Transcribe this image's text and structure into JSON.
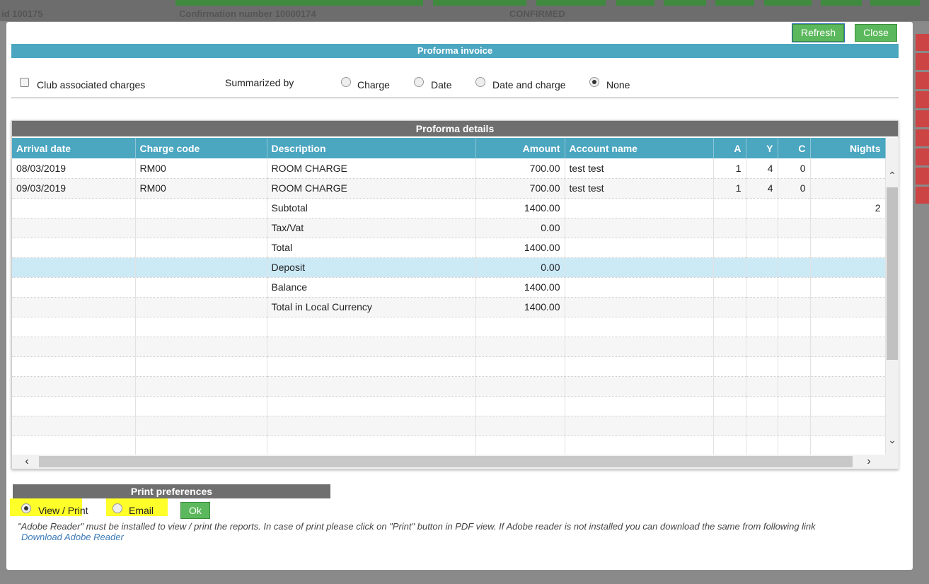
{
  "background": {
    "id_text": "id  100175",
    "confirmation_text": "Confirmation number  10000174",
    "status_text": "CONFIRMED"
  },
  "modal": {
    "refresh_label": "Refresh",
    "close_label": "Close",
    "title": "Proforma invoice",
    "options": {
      "club_label": "Club associated charges",
      "summarized_label": "Summarized by",
      "radios": [
        "Charge",
        "Date",
        "Date and charge",
        "None"
      ],
      "selected": "None"
    },
    "details": {
      "title": "Proforma details",
      "columns": [
        "Arrival date",
        "Charge code",
        "Description",
        "Amount",
        "Account name",
        "A",
        "Y",
        "C",
        "Nights"
      ],
      "rows": [
        [
          "08/03/2019",
          "RM00",
          "ROOM CHARGE",
          "700.00",
          "test test",
          "1",
          "4",
          "0",
          ""
        ],
        [
          "09/03/2019",
          "RM00",
          "ROOM CHARGE",
          "700.00",
          "test test",
          "1",
          "4",
          "0",
          ""
        ],
        [
          "",
          "",
          "Subtotal",
          "1400.00",
          "",
          "",
          "",
          "",
          "2"
        ],
        [
          "",
          "",
          "Tax/Vat",
          "0.00",
          "",
          "",
          "",
          "",
          ""
        ],
        [
          "",
          "",
          "Total",
          "1400.00",
          "",
          "",
          "",
          "",
          ""
        ],
        [
          "",
          "",
          "Deposit",
          "0.00",
          "",
          "",
          "",
          "",
          ""
        ],
        [
          "",
          "",
          "Balance",
          "1400.00",
          "",
          "",
          "",
          "",
          ""
        ],
        [
          "",
          "",
          "Total in Local Currency",
          "1400.00",
          "",
          "",
          "",
          "",
          ""
        ]
      ]
    },
    "print_prefs": {
      "title": "Print preferences",
      "view_print_label": "View / Print",
      "email_label": "Email",
      "ok_label": "Ok",
      "note": "\"Adobe Reader\" must be installed to view / print the reports. In case of print please click on \"Print\" button in PDF view. If Adobe reader is not installed you can download the same from following link",
      "download_link": "Download Adobe Reader"
    }
  }
}
